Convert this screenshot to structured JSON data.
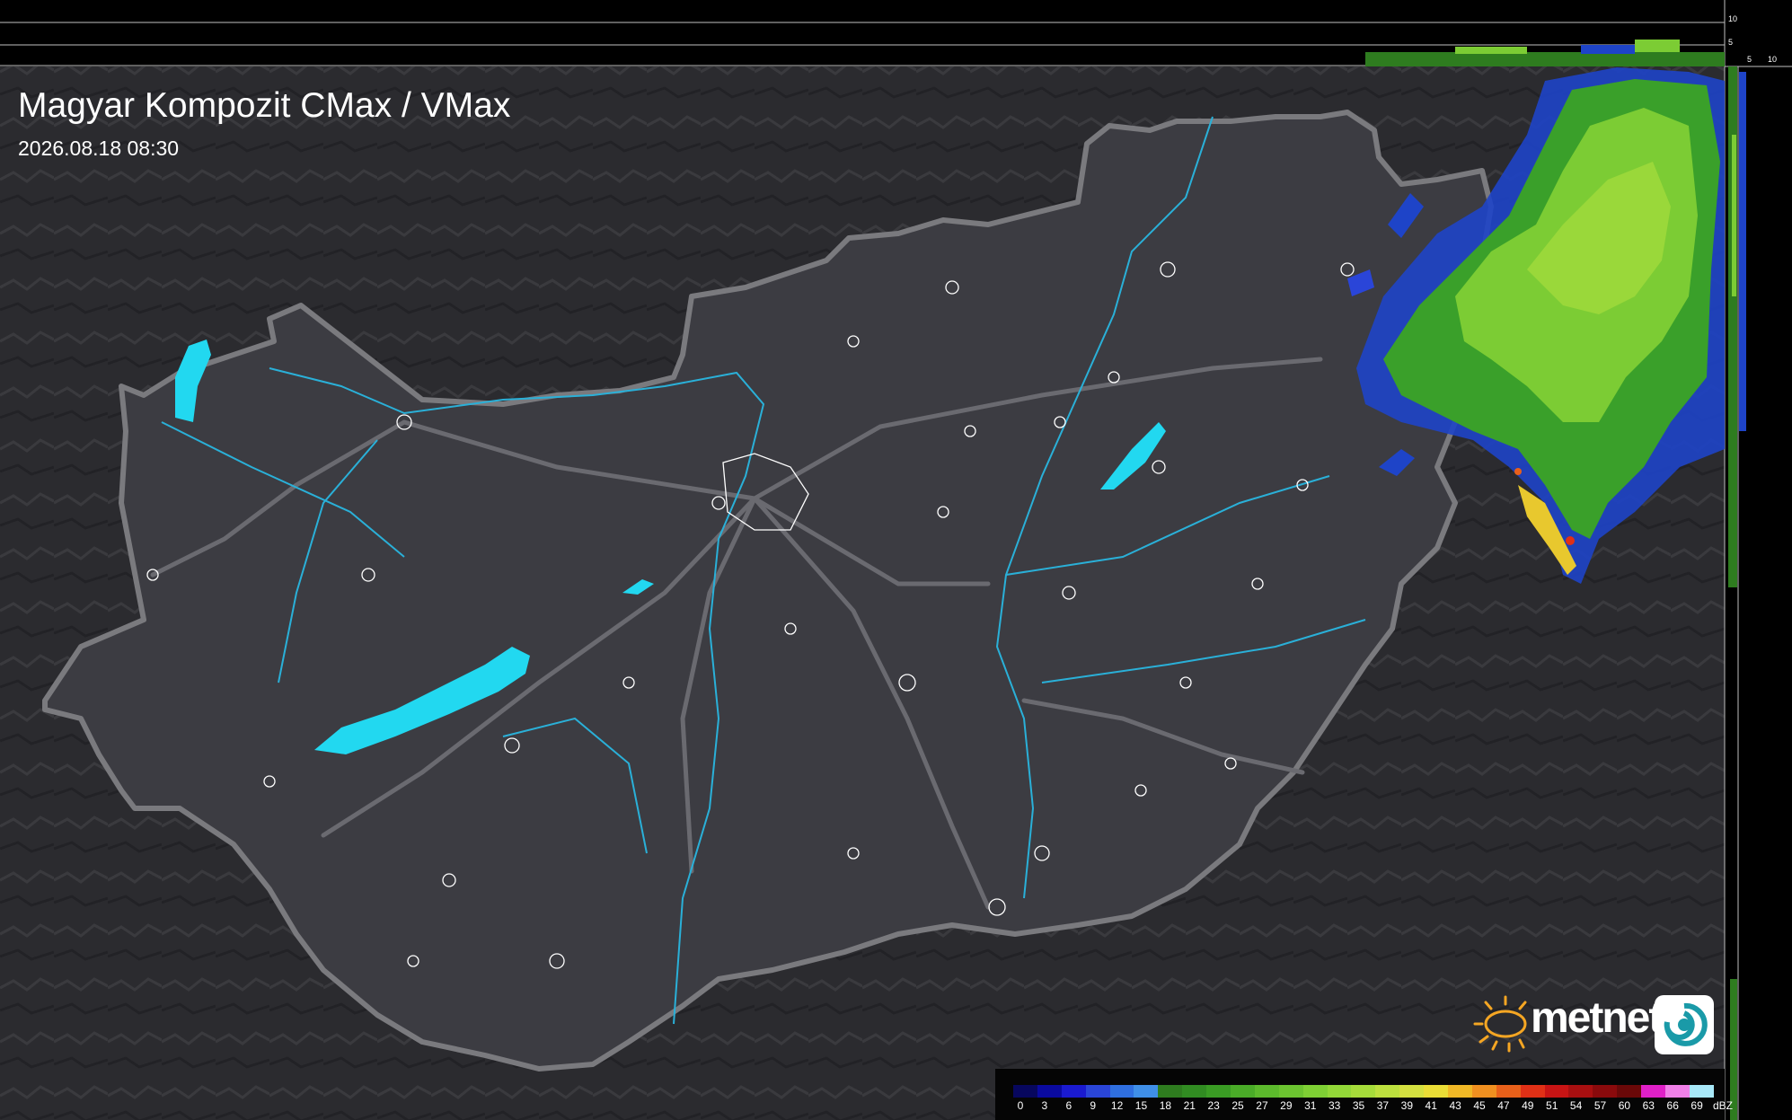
{
  "map": {
    "title": "Magyar Kompozit CMax / VMax",
    "timestamp": "2026.08.18 08:30",
    "side_ticks": {
      "top": "10",
      "mid": "5",
      "right_a": "5",
      "right_b": "10"
    }
  },
  "logo": {
    "text": "metnet",
    "icon": "sun-icon"
  },
  "legend": {
    "unit": "dBZ",
    "labels": [
      "0",
      "3",
      "6",
      "9",
      "12",
      "15",
      "18",
      "21",
      "23",
      "25",
      "27",
      "29",
      "31",
      "33",
      "35",
      "37",
      "39",
      "41",
      "43",
      "45",
      "47",
      "49",
      "51",
      "54",
      "57",
      "60",
      "63",
      "66",
      "69"
    ],
    "colors": [
      "#07075e",
      "#0a0aa0",
      "#1a1ad0",
      "#2a45d8",
      "#2f6fe0",
      "#3f8fe8",
      "#2e7c1f",
      "#318c22",
      "#3a9c24",
      "#4aac28",
      "#5cba2c",
      "#6cc430",
      "#7fd034",
      "#93d838",
      "#a6dc3a",
      "#bde03e",
      "#d4e040",
      "#eadd36",
      "#f0b826",
      "#f09020",
      "#e8601a",
      "#e03016",
      "#c81414",
      "#a80f10",
      "#8a0a0c",
      "#6a0808",
      "#e020c8",
      "#f080e8",
      "#a8e8f8"
    ]
  },
  "colors": {
    "water": "#22d8f0",
    "river": "#2ab0d8",
    "border": "#7a7a7e",
    "roads": "#6a6a70",
    "terrain": "#2a2a2e"
  }
}
